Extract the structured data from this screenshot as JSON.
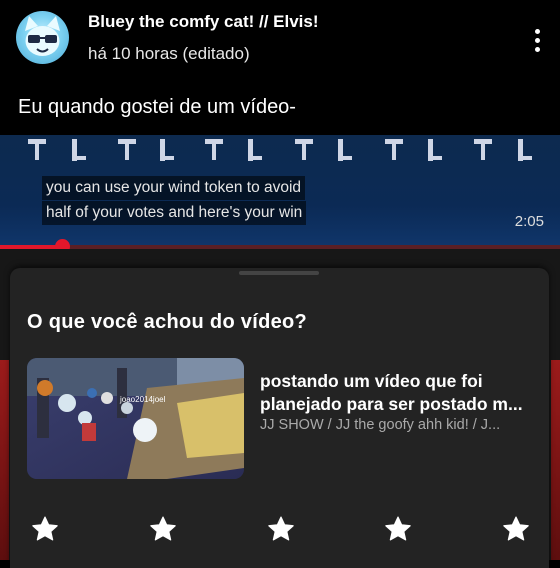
{
  "post": {
    "author": "Bluey the comfy cat! // Elvis!",
    "timestamp": "há 10 horas (editado)",
    "text": "Eu quando gostei de um vídeo-",
    "more_icon": "more-vertical-icon"
  },
  "video": {
    "caption_line1": "you can use your wind token to avoid",
    "caption_line2": "half of your votes and here's your win",
    "duration": "2:05",
    "progress": 0.11,
    "progress_color": "#e2172b"
  },
  "sheet": {
    "title": "O que você achou do vídeo?",
    "video_title_line1": "postando um vídeo que foi",
    "video_title_line2": "planejado para ser postado m...",
    "channel": "JJ SHOW / JJ the goofy ahh kid! / J...",
    "thumbnail_text": "joao2014joel",
    "stars": [
      {
        "icon": "star-icon",
        "filled": true
      },
      {
        "icon": "star-icon",
        "filled": true
      },
      {
        "icon": "star-icon",
        "filled": true
      },
      {
        "icon": "star-icon",
        "filled": true
      },
      {
        "icon": "star-icon",
        "filled": true
      }
    ],
    "star_color": "#ffffff"
  }
}
